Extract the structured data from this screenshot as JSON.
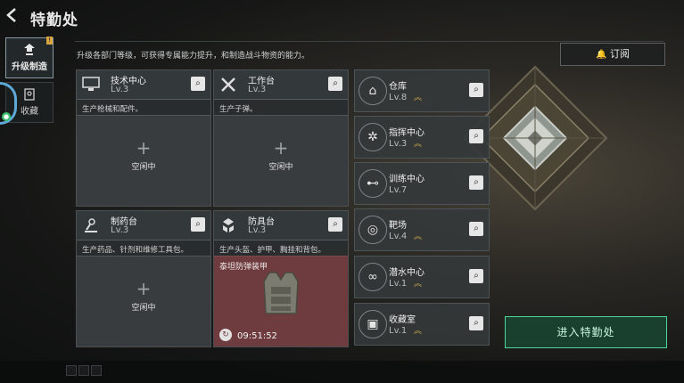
{
  "header": {
    "title": "特勤处"
  },
  "sidebar": {
    "tabs": [
      {
        "label": "升级制造",
        "icon": "upgrade-icon",
        "badge": "!"
      },
      {
        "label": "收藏",
        "icon": "collection-icon"
      }
    ]
  },
  "description": "升级各部门等级，可获得专属能力提升，和制造战斗物资的能力。",
  "subscribe_label": "订阅",
  "cards": [
    {
      "name": "技术中心",
      "level": "Lv.3",
      "desc": "生产枪械和配件。",
      "status": "空闲中",
      "icon": "computer-icon"
    },
    {
      "name": "工作台",
      "level": "Lv.3",
      "desc": "生产子弹。",
      "status": "空闲中",
      "icon": "tools-icon"
    },
    {
      "name": "制药台",
      "level": "Lv.3",
      "desc": "生产药品、针剂和维修工具包。",
      "status": "空闲中",
      "icon": "microscope-icon"
    },
    {
      "name": "防具台",
      "level": "Lv.3",
      "desc": "生产头盔、护甲、胸挂和背包。",
      "crafting_item": "泰坦防弹装甲",
      "timer": "09:51:52",
      "icon": "armor-bench-icon"
    }
  ],
  "facilities": [
    {
      "name": "仓库",
      "level": "Lv.8",
      "upgradable": true,
      "icon": "warehouse-icon"
    },
    {
      "name": "指挥中心",
      "level": "Lv.3",
      "upgradable": true,
      "icon": "command-icon"
    },
    {
      "name": "训练中心",
      "level": "Lv.7",
      "upgradable": false,
      "icon": "dumbbell-icon"
    },
    {
      "name": "靶场",
      "level": "Lv.4",
      "upgradable": true,
      "icon": "target-icon"
    },
    {
      "name": "潜水中心",
      "level": "Lv.1",
      "upgradable": true,
      "icon": "diving-icon"
    },
    {
      "name": "收藏室",
      "level": "Lv.1",
      "upgradable": true,
      "icon": "collection-room-icon"
    }
  ],
  "enter_button": "进入特勤处",
  "colors": {
    "accent": "#4fd49b",
    "crafting": "#6e3c3f",
    "upgrade_arrow": "#c9a94a"
  }
}
